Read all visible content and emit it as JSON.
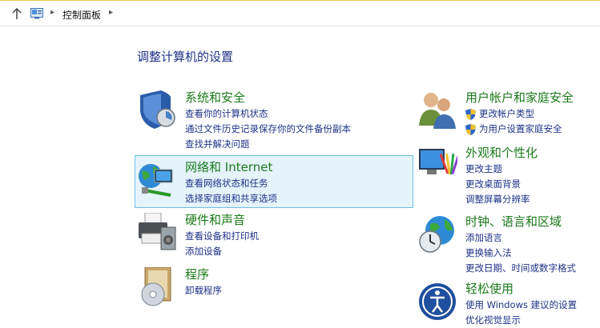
{
  "address": {
    "crumb": "控制面板",
    "separator": "▸"
  },
  "heading": "调整计算机的设置",
  "left_categories": [
    {
      "title": "系统和安全",
      "icon": "shield-icon",
      "links": [
        "查看你的计算机状态",
        "通过文件历史记录保存你的文件备份副本",
        "查找并解决问题"
      ]
    },
    {
      "title": "网络和 Internet",
      "icon": "network-globe-icon",
      "links": [
        "查看网络状态和任务",
        "选择家庭组和共享选项"
      ]
    },
    {
      "title": "硬件和声音",
      "icon": "printer-icon",
      "links": [
        "查看设备和打印机",
        "添加设备"
      ]
    },
    {
      "title": "程序",
      "icon": "programs-disc-icon",
      "links": [
        "卸载程序"
      ]
    }
  ],
  "right_categories": [
    {
      "title": "用户帐户和家庭安全",
      "icon": "users-icon",
      "links": [
        "更改帐户类型",
        "为用户设置家庭安全"
      ]
    },
    {
      "title": "外观和个性化",
      "icon": "monitor-palette-icon",
      "links": [
        "更改主题",
        "更改桌面背景",
        "调整屏幕分辨率"
      ]
    },
    {
      "title": "时钟、语言和区域",
      "icon": "globe-clock-icon",
      "links": [
        "添加语言",
        "更换输入法",
        "更改日期、时间或数字格式"
      ]
    },
    {
      "title": "轻松使用",
      "icon": "ease-of-access-icon",
      "links": [
        "使用 Windows 建议的设置",
        "优化视觉显示"
      ]
    }
  ],
  "colors": {
    "link": "#1e3287",
    "category_title": "#1b7a1b",
    "highlight_bg": "#e5f3fb",
    "highlight_border": "#70c0e7"
  }
}
